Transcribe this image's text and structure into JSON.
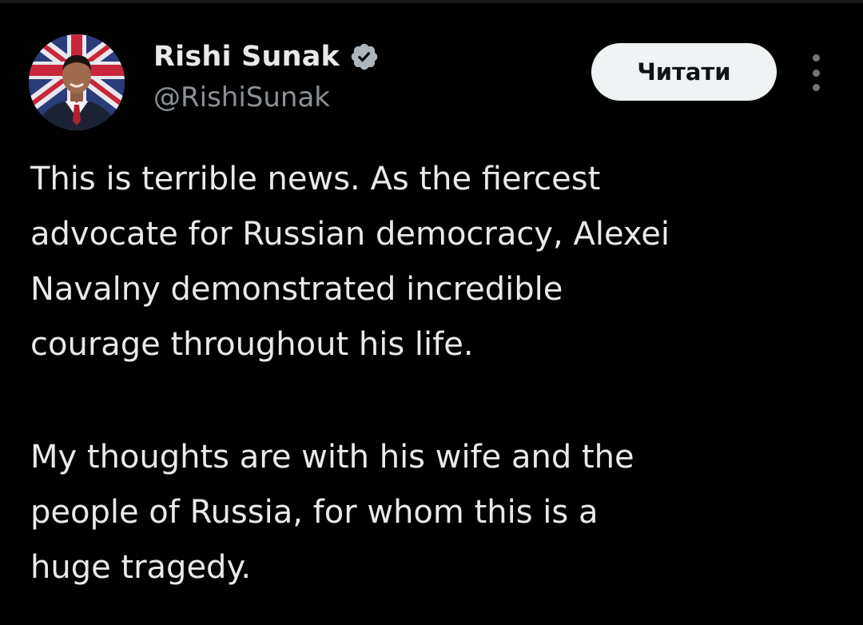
{
  "author": {
    "display_name": "Rishi Sunak",
    "handle": "@RishiSunak",
    "verified": true,
    "avatar": "profile-photo"
  },
  "actions": {
    "follow_label": "Читати",
    "more": "more-options-icon"
  },
  "tweet": {
    "paragraph_1": "This is terrible news. As the fiercest\nadvocate for Russian democracy, Alexei\nNavalny demonstrated incredible\ncourage throughout his life.",
    "paragraph_2": "My thoughts are with his wife and the\npeople of Russia, for whom this is a\nhuge tragedy."
  },
  "colors": {
    "background": "#000000",
    "text_primary": "#e7e9ea",
    "text_secondary": "#8b9097",
    "button_bg": "#eff3f4",
    "verified_badge": "#aeb6bd"
  }
}
